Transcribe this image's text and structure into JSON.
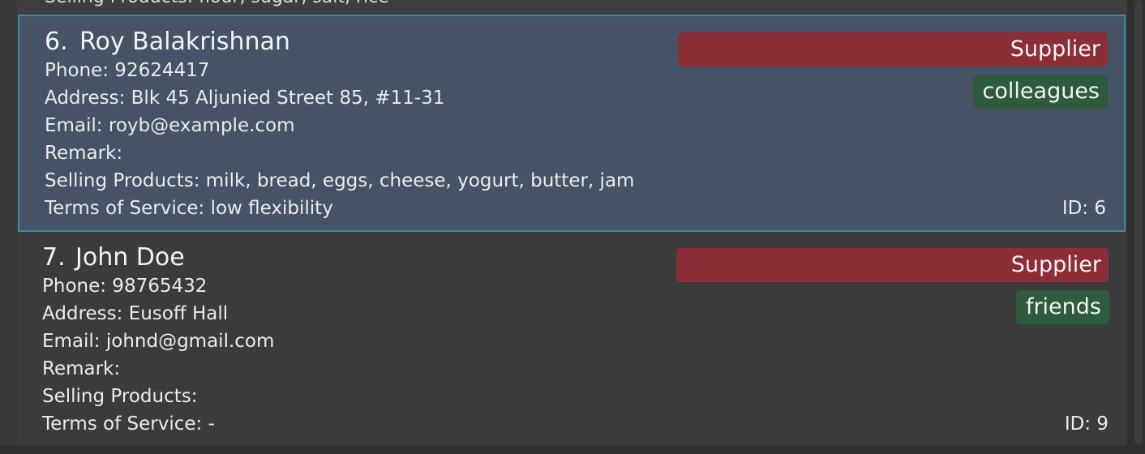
{
  "previous_card": {
    "cut_text": "Selling Products: flour, sugar, salt, rice"
  },
  "persons": [
    {
      "index": "6.",
      "name": "Roy Balakrishnan",
      "phone": "Phone: 92624417",
      "address": "Address: Blk 45 Aljunied Street 85, #11-31",
      "email": "Email: royb@example.com",
      "remark": "Remark:",
      "selling_products": "Selling Products: milk, bread, eggs, cheese, yogurt, butter, jam",
      "terms_of_service": "Terms of Service: low flexibility",
      "role_tag": "Supplier",
      "group_tag": "colleagues",
      "id": "ID: 6",
      "selected": true
    },
    {
      "index": "7.",
      "name": "John Doe",
      "phone": "Phone: 98765432",
      "address": "Address: Eusoff Hall",
      "email": "Email: johnd@gmail.com",
      "remark": "Remark:",
      "selling_products": "Selling Products:",
      "terms_of_service": "Terms of Service: -",
      "role_tag": "Supplier",
      "group_tag": "friends",
      "id": "ID: 9",
      "selected": false
    }
  ],
  "colors": {
    "selected_card_bg": "#465265",
    "selected_card_border": "#3b8ba3",
    "card_bg": "#3b3b3b",
    "role_tag_bg": "#8b2e38",
    "group_tag_bg": "#2e5a3e",
    "text": "#ececec"
  }
}
